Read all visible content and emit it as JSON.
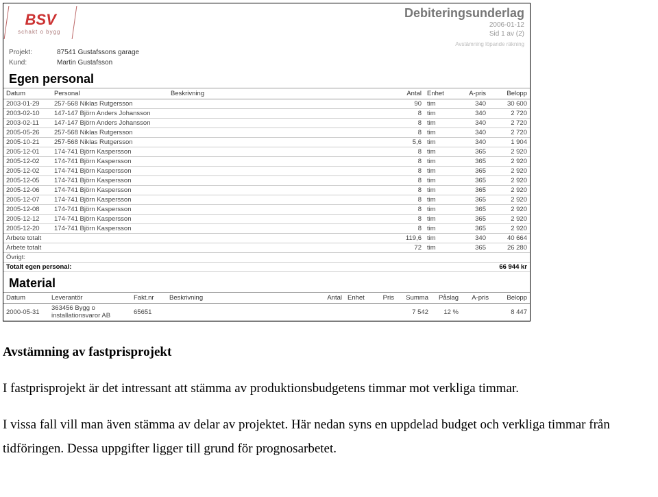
{
  "header": {
    "logo_text": "BSV",
    "logo_sub": "schakt o bygg",
    "title": "Debiteringsunderlag",
    "date": "2006-01-12",
    "page": "Sid 1 av (2)",
    "note": "Avstämning löpande räkning"
  },
  "meta": {
    "projekt_label": "Projekt:",
    "projekt_value": "87541 Gustafssons garage",
    "kund_label": "Kund:",
    "kund_value": "Martin Gustafsson"
  },
  "section_personal": {
    "title": "Egen personal",
    "columns": [
      "Datum",
      "Personal",
      "Beskrivning",
      "Antal",
      "Enhet",
      "A-pris",
      "Belopp"
    ],
    "rows": [
      {
        "datum": "2003-01-29",
        "personal": "257-568 Niklas Rutgersson",
        "beskr": "",
        "antal": "90",
        "enhet": "tim",
        "apris": "340",
        "belopp": "30 600"
      },
      {
        "datum": "2003-02-10",
        "personal": "147-147 Björn Anders Johansson",
        "beskr": "",
        "antal": "8",
        "enhet": "tim",
        "apris": "340",
        "belopp": "2 720"
      },
      {
        "datum": "2003-02-11",
        "personal": "147-147 Björn Anders Johansson",
        "beskr": "",
        "antal": "8",
        "enhet": "tim",
        "apris": "340",
        "belopp": "2 720"
      },
      {
        "datum": "2005-05-26",
        "personal": "257-568 Niklas Rutgersson",
        "beskr": "",
        "antal": "8",
        "enhet": "tim",
        "apris": "340",
        "belopp": "2 720"
      },
      {
        "datum": "2005-10-21",
        "personal": "257-568 Niklas Rutgersson",
        "beskr": "",
        "antal": "5,6",
        "enhet": "tim",
        "apris": "340",
        "belopp": "1 904"
      },
      {
        "datum": "2005-12-01",
        "personal": "174-741 Björn Kaspersson",
        "beskr": "",
        "antal": "8",
        "enhet": "tim",
        "apris": "365",
        "belopp": "2 920"
      },
      {
        "datum": "2005-12-02",
        "personal": "174-741 Björn Kaspersson",
        "beskr": "",
        "antal": "8",
        "enhet": "tim",
        "apris": "365",
        "belopp": "2 920"
      },
      {
        "datum": "2005-12-02",
        "personal": "174-741 Björn Kaspersson",
        "beskr": "",
        "antal": "8",
        "enhet": "tim",
        "apris": "365",
        "belopp": "2 920"
      },
      {
        "datum": "2005-12-05",
        "personal": "174-741 Björn Kaspersson",
        "beskr": "",
        "antal": "8",
        "enhet": "tim",
        "apris": "365",
        "belopp": "2 920"
      },
      {
        "datum": "2005-12-06",
        "personal": "174-741 Björn Kaspersson",
        "beskr": "",
        "antal": "8",
        "enhet": "tim",
        "apris": "365",
        "belopp": "2 920"
      },
      {
        "datum": "2005-12-07",
        "personal": "174-741 Björn Kaspersson",
        "beskr": "",
        "antal": "8",
        "enhet": "tim",
        "apris": "365",
        "belopp": "2 920"
      },
      {
        "datum": "2005-12-08",
        "personal": "174-741 Björn Kaspersson",
        "beskr": "",
        "antal": "8",
        "enhet": "tim",
        "apris": "365",
        "belopp": "2 920"
      },
      {
        "datum": "2005-12-12",
        "personal": "174-741 Björn Kaspersson",
        "beskr": "",
        "antal": "8",
        "enhet": "tim",
        "apris": "365",
        "belopp": "2 920"
      },
      {
        "datum": "2005-12-20",
        "personal": "174-741 Björn Kaspersson",
        "beskr": "",
        "antal": "8",
        "enhet": "tim",
        "apris": "365",
        "belopp": "2 920"
      }
    ],
    "totals": [
      {
        "label": "Arbete totalt",
        "antal": "119,6",
        "enhet": "tim",
        "apris": "340",
        "belopp": "40 664"
      },
      {
        "label": "Arbete totalt",
        "antal": "72",
        "enhet": "tim",
        "apris": "365",
        "belopp": "26 280"
      }
    ],
    "ovrigt_label": "Övrigt:",
    "grand_label": "Totalt egen personal:",
    "grand_value": "66 944 kr"
  },
  "section_material": {
    "title": "Material",
    "columns": [
      "Datum",
      "Leverantör",
      "Fakt.nr",
      "Beskrivning",
      "Antal",
      "Enhet",
      "Pris",
      "Summa",
      "Påslag",
      "A-pris",
      "Belopp"
    ],
    "rows": [
      {
        "datum": "2000-05-31",
        "lev": "363456 Bygg o installationsvaror AB",
        "fakt": "65651",
        "beskr": "",
        "antal": "",
        "enhet": "",
        "pris": "",
        "summa": "7 542",
        "paslag": "12 %",
        "apris": "",
        "belopp": "8 447"
      }
    ]
  },
  "caption": {
    "title": "Avstämning av fastprisprojekt",
    "p1": "I fastprisprojekt är det intressant att stämma av produktionsbudgetens timmar mot verkliga timmar.",
    "p2": "I vissa fall vill man även stämma av delar av projektet. Här nedan syns en uppdelad budget och verkliga timmar från tidföringen. Dessa uppgifter ligger till grund för prognosarbetet."
  }
}
